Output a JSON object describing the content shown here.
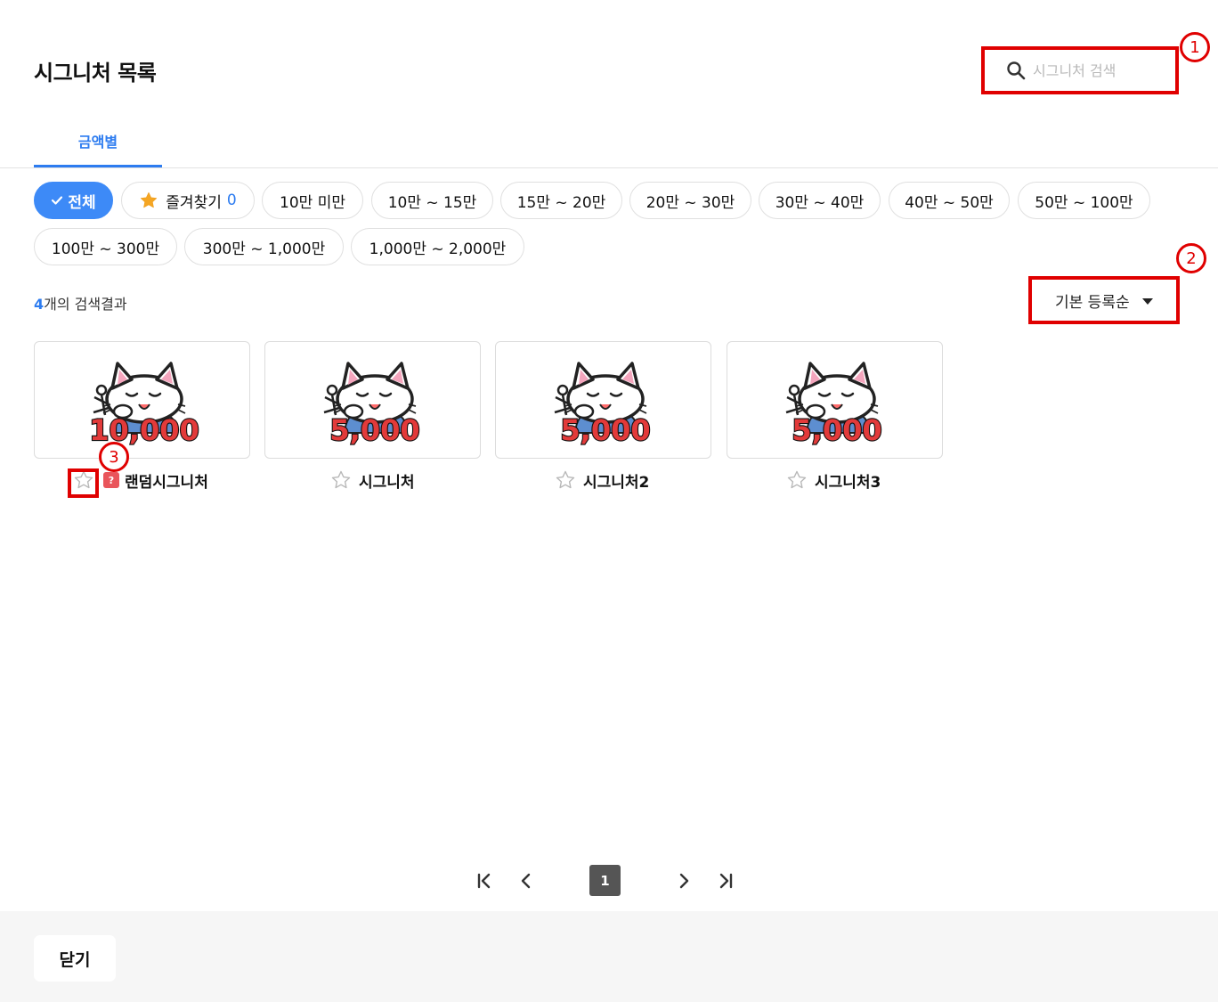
{
  "header": {
    "title": "시그니처 목록",
    "search_placeholder": "시그니처 검색"
  },
  "tabs": [
    {
      "label": "금액별",
      "active": true
    }
  ],
  "filters": {
    "all": "전체",
    "favorites_label": "즐겨찾기",
    "favorites_count": "0",
    "ranges": [
      "10만 미만",
      "10만 ~ 15만",
      "15만 ~ 20만",
      "20만 ~ 30만",
      "30만 ~ 40만",
      "40만 ~ 50만",
      "50만 ~ 100만",
      "100만 ~ 300만",
      "300만 ~ 1,000만",
      "1,000만 ~ 2,000만"
    ]
  },
  "results": {
    "count": "4",
    "suffix": "개의 검색결과"
  },
  "sort": {
    "selected": "기본 등록순"
  },
  "items": [
    {
      "amount": "10,000",
      "name": "랜덤시그니처",
      "random": true,
      "random_badge": "?"
    },
    {
      "amount": "5,000",
      "name": "시그니처",
      "random": false
    },
    {
      "amount": "5,000",
      "name": "시그니처2",
      "random": false
    },
    {
      "amount": "5,000",
      "name": "시그니처3",
      "random": false
    }
  ],
  "pagination": {
    "current": "1"
  },
  "footer": {
    "close_label": "닫기"
  },
  "markers": [
    "1",
    "2",
    "3"
  ],
  "colors": {
    "accent": "#2d7cf0",
    "highlight": "#e00000",
    "star": "#f5a623"
  }
}
